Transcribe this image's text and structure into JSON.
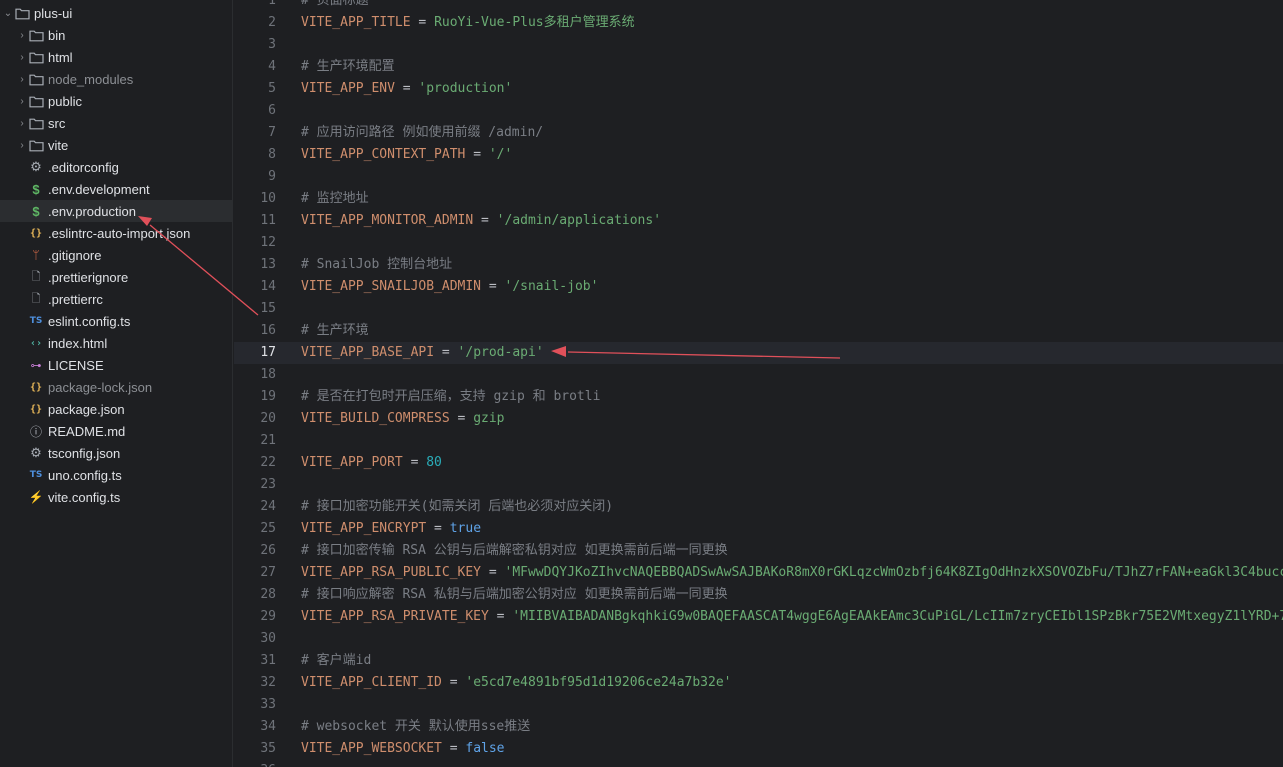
{
  "sidebar": {
    "root": {
      "label": "plus-ui",
      "expanded": true
    },
    "items": [
      {
        "label": "bin",
        "kind": "folder"
      },
      {
        "label": "html",
        "kind": "folder"
      },
      {
        "label": "node_modules",
        "kind": "folder",
        "dim": true
      },
      {
        "label": "public",
        "kind": "folder"
      },
      {
        "label": "src",
        "kind": "folder"
      },
      {
        "label": "vite",
        "kind": "folder"
      },
      {
        "label": ".editorconfig",
        "kind": "gear-icon"
      },
      {
        "label": ".env.development",
        "kind": "dollar-icon"
      },
      {
        "label": ".env.production",
        "kind": "dollar-icon",
        "selected": true
      },
      {
        "label": ".eslintrc-auto-import.json",
        "kind": "json-icon"
      },
      {
        "label": ".gitignore",
        "kind": "git-icon"
      },
      {
        "label": ".prettierignore",
        "kind": "file-icon"
      },
      {
        "label": ".prettierrc",
        "kind": "file-icon"
      },
      {
        "label": "eslint.config.ts",
        "kind": "ts-icon"
      },
      {
        "label": "index.html",
        "kind": "html-icon"
      },
      {
        "label": "LICENSE",
        "kind": "license-icon"
      },
      {
        "label": "package-lock.json",
        "kind": "json-icon",
        "dim": true
      },
      {
        "label": "package.json",
        "kind": "json-icon"
      },
      {
        "label": "README.md",
        "kind": "info-icon"
      },
      {
        "label": "tsconfig.json",
        "kind": "gear-icon"
      },
      {
        "label": "uno.config.ts",
        "kind": "ts-icon"
      },
      {
        "label": "vite.config.ts",
        "kind": "bolt-icon"
      }
    ]
  },
  "editor": {
    "current_line": 17,
    "lines": [
      {
        "n": "1",
        "parts": [
          {
            "t": "# 页面标题",
            "c": "cm"
          }
        ]
      },
      {
        "n": "2",
        "parts": [
          {
            "t": "VITE_APP_TITLE",
            "c": "key"
          },
          {
            "t": " = ",
            "c": "eq"
          },
          {
            "t": "RuoYi-Vue-Plus多租户管理系统",
            "c": "plain"
          }
        ]
      },
      {
        "n": "3",
        "parts": []
      },
      {
        "n": "4",
        "parts": [
          {
            "t": "# 生产环境配置",
            "c": "cm"
          }
        ]
      },
      {
        "n": "5",
        "parts": [
          {
            "t": "VITE_APP_ENV",
            "c": "key"
          },
          {
            "t": " = ",
            "c": "eq"
          },
          {
            "t": "'production'",
            "c": "str"
          }
        ]
      },
      {
        "n": "6",
        "parts": []
      },
      {
        "n": "7",
        "parts": [
          {
            "t": "# 应用访问路径 例如使用前缀 /admin/",
            "c": "cm"
          }
        ]
      },
      {
        "n": "8",
        "parts": [
          {
            "t": "VITE_APP_CONTEXT_PATH",
            "c": "key"
          },
          {
            "t": " = ",
            "c": "eq"
          },
          {
            "t": "'/'",
            "c": "str"
          }
        ]
      },
      {
        "n": "9",
        "parts": []
      },
      {
        "n": "10",
        "parts": [
          {
            "t": "# 监控地址",
            "c": "cm"
          }
        ]
      },
      {
        "n": "11",
        "parts": [
          {
            "t": "VITE_APP_MONITOR_ADMIN",
            "c": "key"
          },
          {
            "t": " = ",
            "c": "eq"
          },
          {
            "t": "'/admin/applications'",
            "c": "str"
          }
        ]
      },
      {
        "n": "12",
        "parts": []
      },
      {
        "n": "13",
        "parts": [
          {
            "t": "# SnailJob 控制台地址",
            "c": "cm"
          }
        ]
      },
      {
        "n": "14",
        "parts": [
          {
            "t": "VITE_APP_SNAILJOB_ADMIN",
            "c": "key"
          },
          {
            "t": " = ",
            "c": "eq"
          },
          {
            "t": "'/snail-job'",
            "c": "str"
          }
        ]
      },
      {
        "n": "15",
        "parts": []
      },
      {
        "n": "16",
        "parts": [
          {
            "t": "# 生产环境",
            "c": "cm"
          }
        ]
      },
      {
        "n": "17",
        "parts": [
          {
            "t": "VITE_APP_BASE_API",
            "c": "key"
          },
          {
            "t": " = ",
            "c": "eq"
          },
          {
            "t": "'/prod-api'",
            "c": "str"
          }
        ]
      },
      {
        "n": "18",
        "parts": []
      },
      {
        "n": "19",
        "parts": [
          {
            "t": "# 是否在打包时开启压缩，支持 gzip 和 brotli",
            "c": "cm"
          }
        ]
      },
      {
        "n": "20",
        "parts": [
          {
            "t": "VITE_BUILD_COMPRESS",
            "c": "key"
          },
          {
            "t": " = ",
            "c": "eq"
          },
          {
            "t": "gzip",
            "c": "plain"
          }
        ]
      },
      {
        "n": "21",
        "parts": []
      },
      {
        "n": "22",
        "parts": [
          {
            "t": "VITE_APP_PORT",
            "c": "key"
          },
          {
            "t": " = ",
            "c": "eq"
          },
          {
            "t": "80",
            "c": "num"
          }
        ]
      },
      {
        "n": "23",
        "parts": []
      },
      {
        "n": "24",
        "parts": [
          {
            "t": "# 接口加密功能开关(如需关闭 后端也必须对应关闭)",
            "c": "cm"
          }
        ]
      },
      {
        "n": "25",
        "parts": [
          {
            "t": "VITE_APP_ENCRYPT",
            "c": "key"
          },
          {
            "t": " = ",
            "c": "eq"
          },
          {
            "t": "true",
            "c": "kw"
          }
        ]
      },
      {
        "n": "26",
        "parts": [
          {
            "t": "# 接口加密传输 RSA 公钥与后端解密私钥对应 如更换需前后端一同更换",
            "c": "cm"
          }
        ]
      },
      {
        "n": "27",
        "parts": [
          {
            "t": "VITE_APP_RSA_PUBLIC_KEY",
            "c": "key"
          },
          {
            "t": " = ",
            "c": "eq"
          },
          {
            "t": "'MFwwDQYJKoZIhvcNAQEBBQADSwAwSAJBAKoR8mX0rGKLqzcWmOzbfj64K8ZIgOdHnzkXSOVOZbFu/TJhZ7rFAN+eaGkl3C4bucc",
            "c": "str"
          }
        ]
      },
      {
        "n": "28",
        "parts": [
          {
            "t": "# 接口响应解密 RSA 私钥与后端加密公钥对应 如更换需前后端一同更换",
            "c": "cm"
          }
        ]
      },
      {
        "n": "29",
        "parts": [
          {
            "t": "VITE_APP_RSA_PRIVATE_KEY",
            "c": "key"
          },
          {
            "t": " = ",
            "c": "eq"
          },
          {
            "t": "'MIIBVAIBADANBgkqhkiG9w0BAQEFAASCAT4wggE6AgEAAkEAmc3CuPiGL/LcIIm7zryCEIbl1SPzBkr75E2VMtxegyZ1lYRD+7",
            "c": "str"
          }
        ]
      },
      {
        "n": "30",
        "parts": []
      },
      {
        "n": "31",
        "parts": [
          {
            "t": "# 客户端id",
            "c": "cm"
          }
        ]
      },
      {
        "n": "32",
        "parts": [
          {
            "t": "VITE_APP_CLIENT_ID",
            "c": "key"
          },
          {
            "t": " = ",
            "c": "eq"
          },
          {
            "t": "'e5cd7e4891bf95d1d19206ce24a7b32e'",
            "c": "str"
          }
        ]
      },
      {
        "n": "33",
        "parts": []
      },
      {
        "n": "34",
        "parts": [
          {
            "t": "# websocket 开关 默认使用sse推送",
            "c": "cm"
          }
        ]
      },
      {
        "n": "35",
        "parts": [
          {
            "t": "VITE_APP_WEBSOCKET",
            "c": "key"
          },
          {
            "t": " = ",
            "c": "eq"
          },
          {
            "t": "false",
            "c": "kw"
          }
        ]
      },
      {
        "n": "36",
        "parts": []
      }
    ]
  },
  "colors": {
    "background": "#1e1f22",
    "annotation_arrow": "#e0505a"
  }
}
